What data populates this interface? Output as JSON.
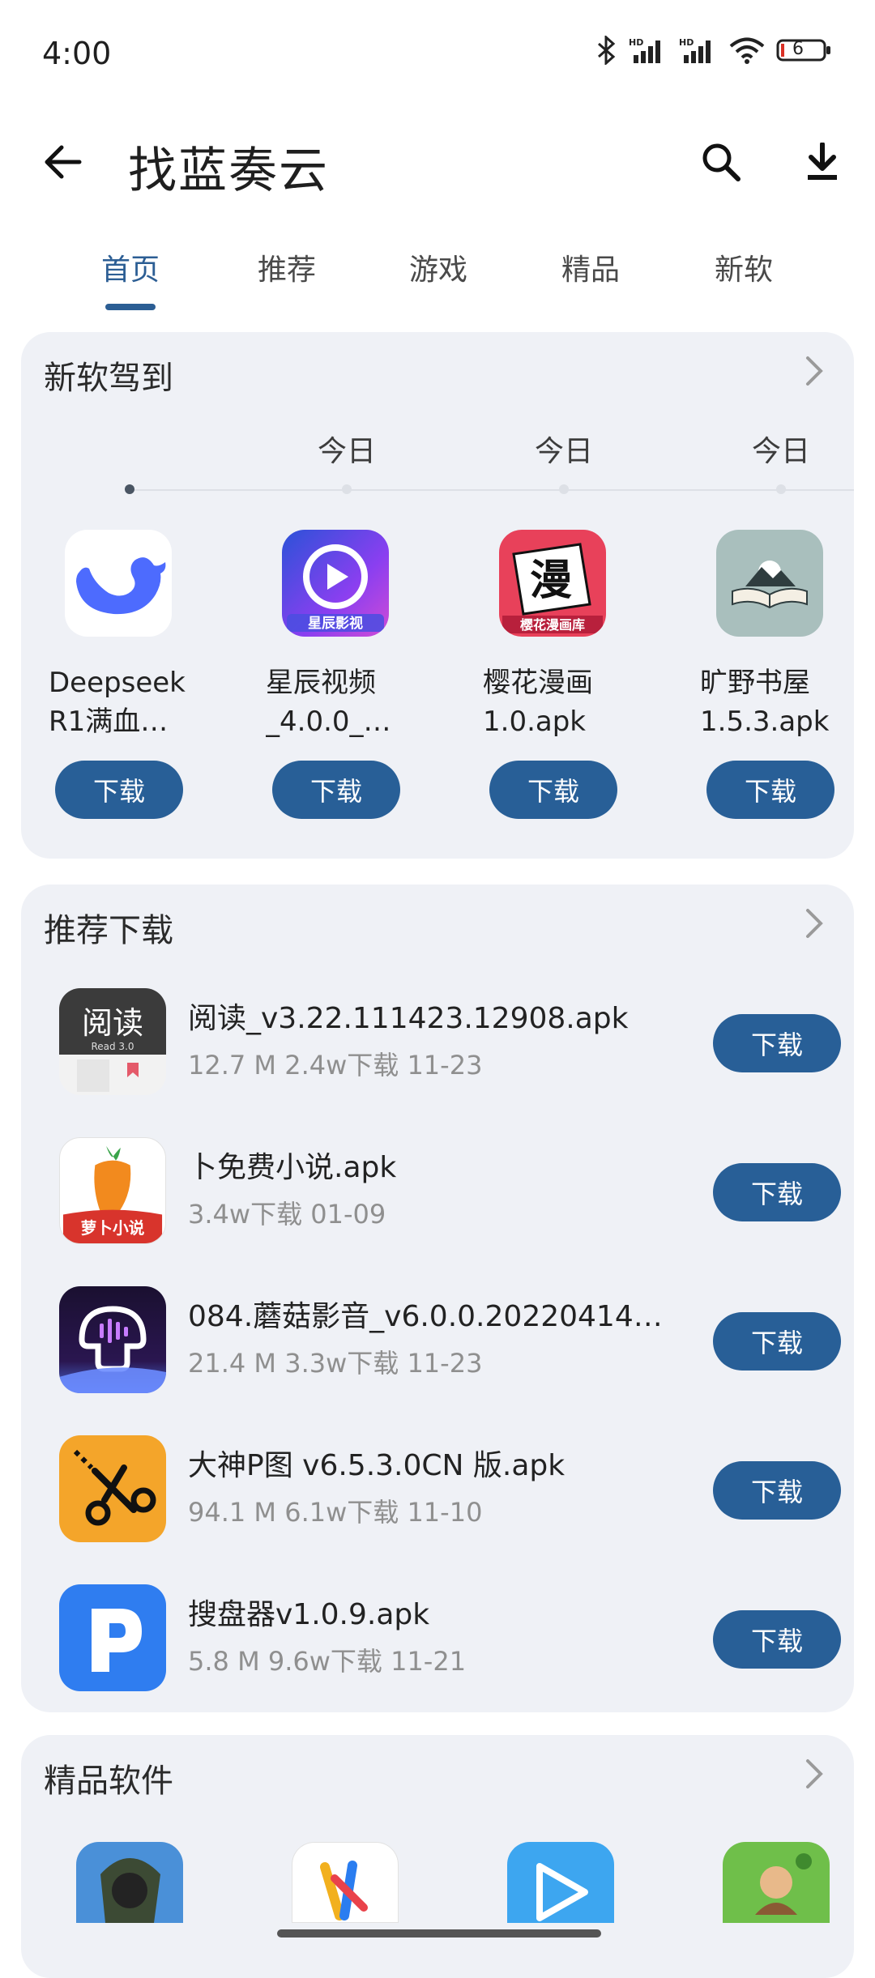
{
  "status_bar": {
    "time": "4:00",
    "battery": "6",
    "signal_tag": "HD"
  },
  "app_bar": {
    "title": "找蓝奏云",
    "back_icon": "arrow-left-icon",
    "search_icon": "search-icon",
    "download_icon": "download-icon"
  },
  "tabs": [
    {
      "label": "首页",
      "active": true
    },
    {
      "label": "推荐",
      "active": false
    },
    {
      "label": "游戏",
      "active": false
    },
    {
      "label": "精品",
      "active": false
    },
    {
      "label": "新软",
      "active": false
    }
  ],
  "new_section": {
    "title": "新软驾到",
    "days": [
      "今日",
      "今日",
      "今日"
    ],
    "apps": [
      {
        "name_line1": "Deepseek",
        "name_line2": "R1满血…",
        "button": "下载",
        "icon": "whale-icon"
      },
      {
        "name_line1": "星辰视频",
        "name_line2": "_4.0.0_…",
        "button": "下载",
        "icon": "play-icon",
        "icon_text": "星辰影视"
      },
      {
        "name_line1": "樱花漫画",
        "name_line2": "1.0.apk",
        "button": "下载",
        "icon": "manga-icon",
        "icon_text": "漫",
        "icon_subtext": "樱花漫画库"
      },
      {
        "name_line1": "旷野书屋",
        "name_line2": "1.5.3.apk",
        "button": "下载",
        "icon": "book-icon"
      }
    ]
  },
  "recommend_section": {
    "title": "推荐下载",
    "items": [
      {
        "title": "阅读_v3.22.111423.12908.apk",
        "meta": "12.7 M  2.4w下载  11-23",
        "button": "下载",
        "icon": "reader-icon",
        "icon_text": "阅读",
        "icon_subtext": "Read 3.0"
      },
      {
        "title": "卜免费小说.apk",
        "meta": " 3.4w下载  01-09",
        "button": "下载",
        "icon": "carrot-icon",
        "icon_text": "萝卜小说"
      },
      {
        "title": "084.蘑菇影音_v6.0.0.2022041420…",
        "meta": "21.4 M  3.3w下载  11-23",
        "button": "下载",
        "icon": "mushroom-icon"
      },
      {
        "title": "大神P图 v6.5.3.0CN 版.apk",
        "meta": "94.1 M  6.1w下载  11-10",
        "button": "下载",
        "icon": "scissors-icon"
      },
      {
        "title": "搜盘器v1.0.9.apk",
        "meta": "5.8 M  9.6w下载  11-21",
        "button": "下载",
        "icon": "p-letter-icon"
      }
    ]
  },
  "premium_section": {
    "title": "精品软件"
  },
  "colors": {
    "accent": "#285f97",
    "card_bg": "#eff1f6",
    "tab_active": "#2c5e94"
  }
}
